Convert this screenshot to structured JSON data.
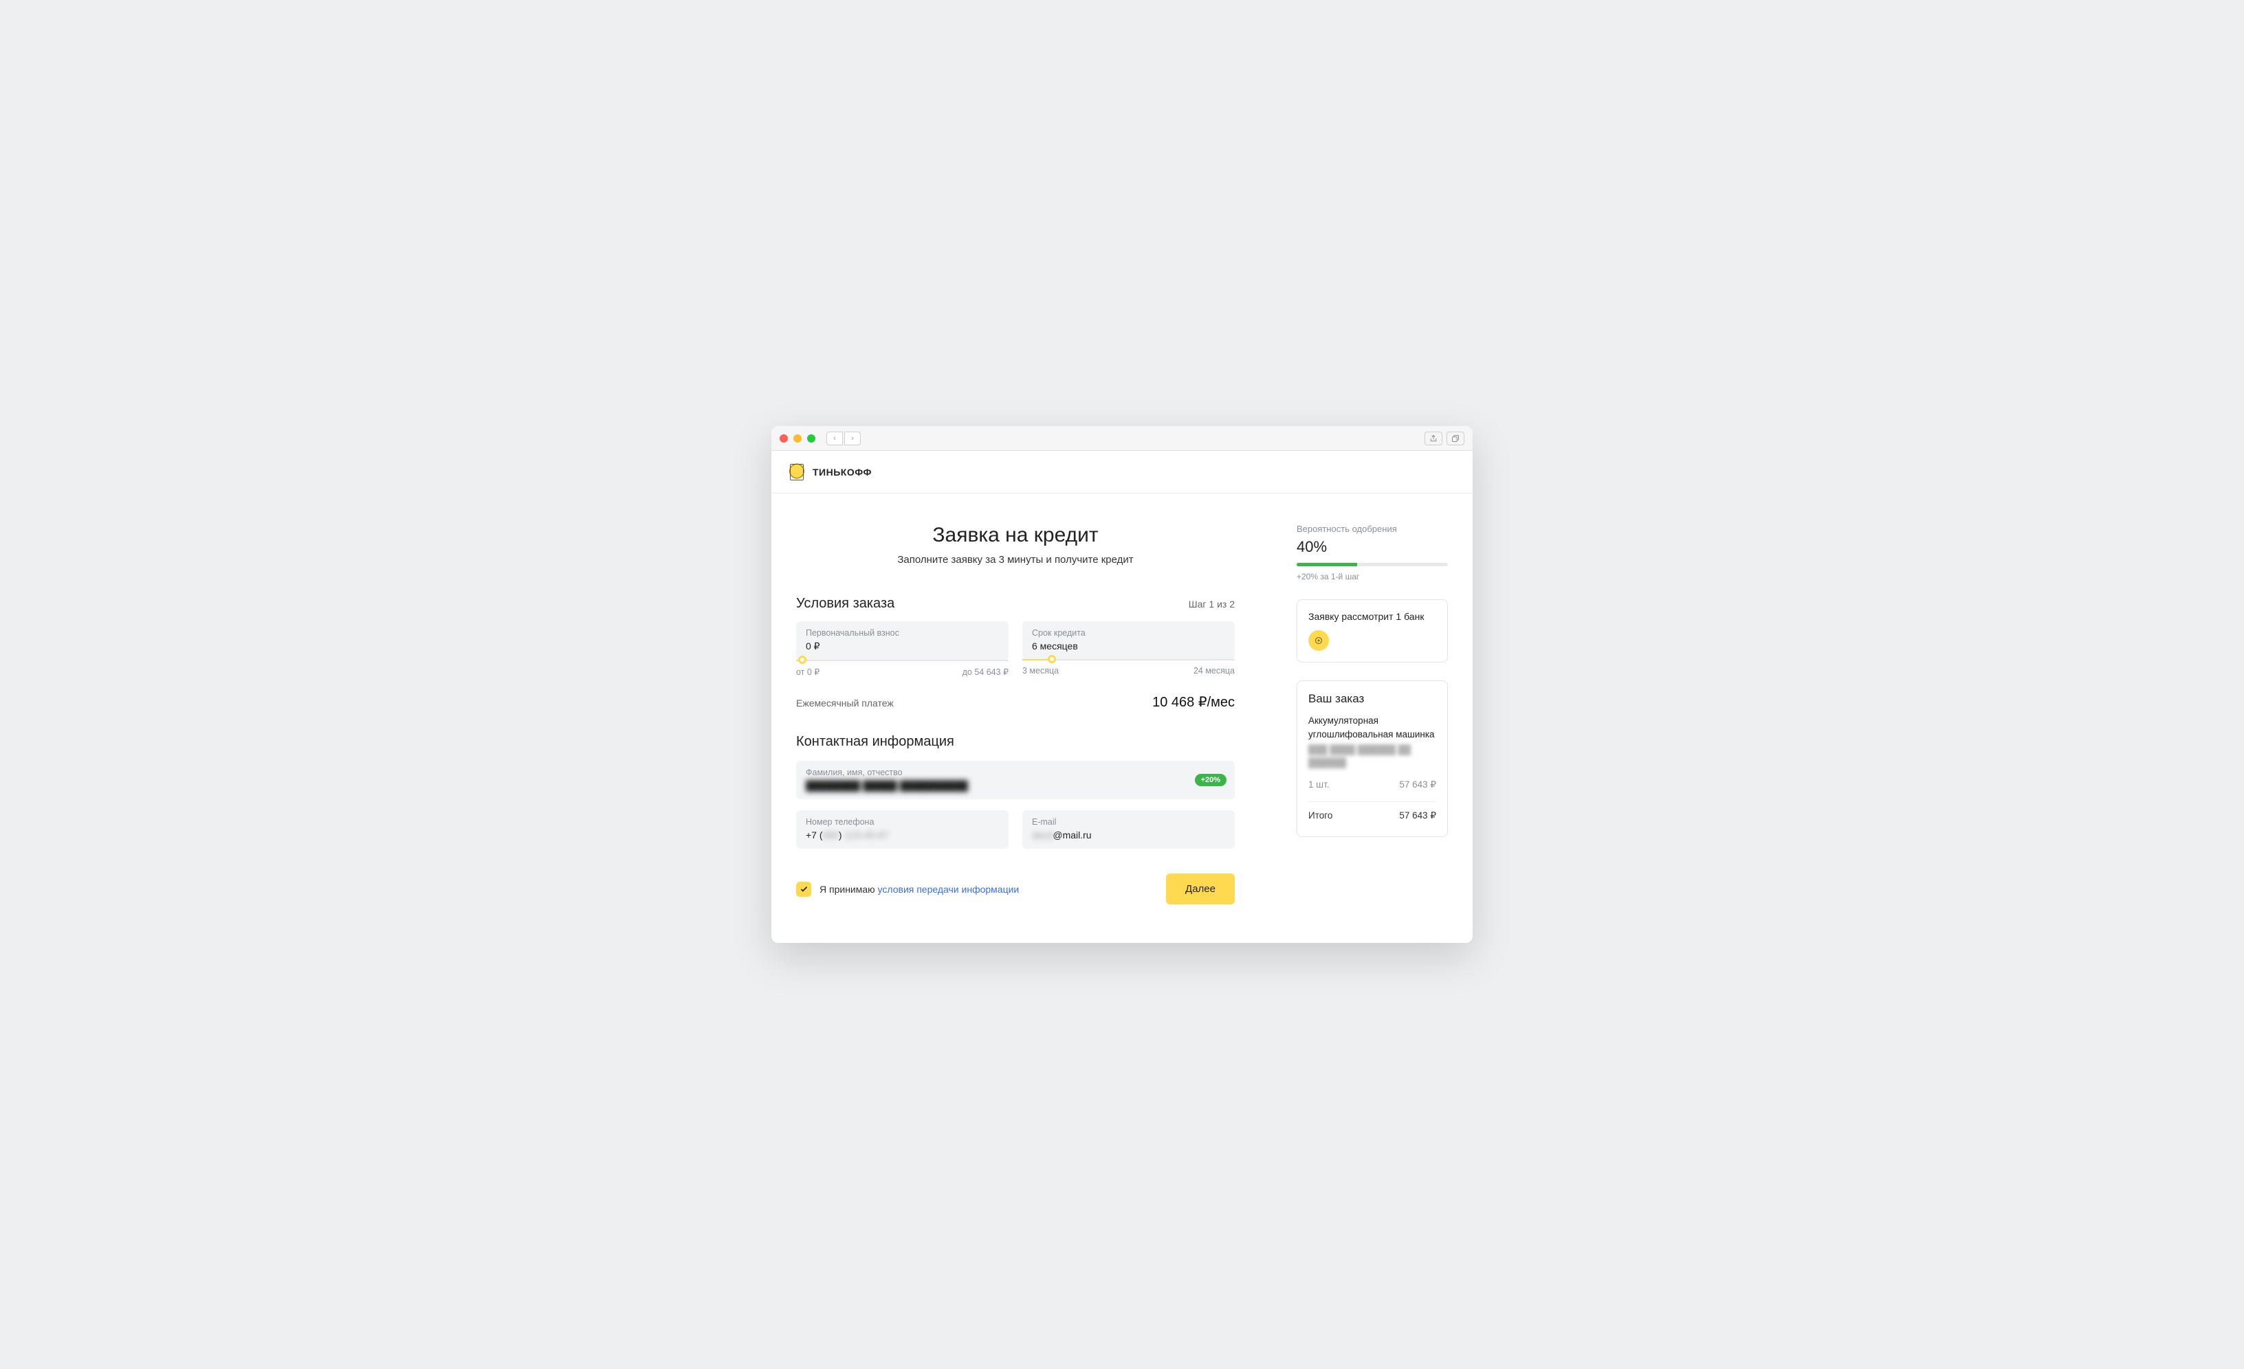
{
  "brand": {
    "name": "ТИНЬКОФФ"
  },
  "hero": {
    "title": "Заявка на кредит",
    "subtitle": "Заполните заявку за 3 минуты и получите кредит"
  },
  "conditions": {
    "title": "Условия заказа",
    "step": "Шаг 1 из 2",
    "downpayment": {
      "label": "Первоначальный взнос",
      "value": "0 ₽",
      "min": "от 0 ₽",
      "max": "до 54 643 ₽",
      "percent": 3
    },
    "term": {
      "label": "Срок кредита",
      "value": "6 месяцев",
      "min": "3 месяца",
      "max": "24 месяца",
      "percent": 14
    },
    "monthly": {
      "label": "Ежемесячный платеж",
      "value": "10 468 ₽/мес"
    }
  },
  "contact": {
    "title": "Контактная информация",
    "fio": {
      "label": "Фамилия, имя, отчество",
      "value": "████████ █████ ██████████",
      "badge": "+20%"
    },
    "phone": {
      "label": "Номер телефона",
      "value": "+7 (███) ███-██-██"
    },
    "email": {
      "label": "E-mail",
      "value": "████@mail.ru"
    }
  },
  "consent": {
    "prefix": "Я принимаю ",
    "link": "условия передачи информации"
  },
  "actions": {
    "next": "Далее"
  },
  "approval": {
    "label": "Вероятность одобрения",
    "percent_text": "40%",
    "percent": 40,
    "note": "+20% за 1-й шаг"
  },
  "bank": {
    "text": "Заявку рассмотрит 1 банк"
  },
  "order": {
    "title": "Ваш заказ",
    "item_name": "Аккумуляторная углошлифовальная машинка",
    "item_sub": "███ ████ ██████ ██ ██████",
    "qty": "1 шт.",
    "price": "57 643 ₽",
    "total_label": "Итого",
    "total_value": "57 643 ₽"
  }
}
